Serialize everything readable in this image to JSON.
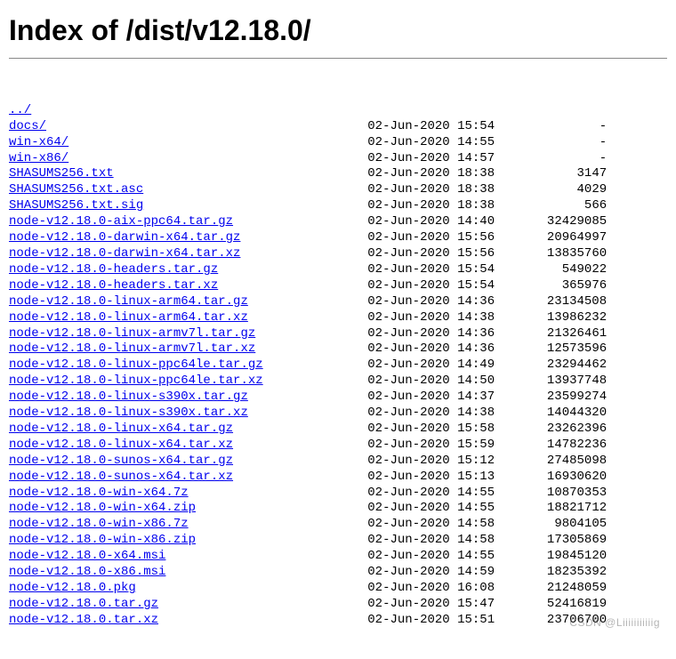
{
  "title": "Index of /dist/v12.18.0/",
  "parent_label": "../",
  "watermark": "CSDN @Liiiiiiiiiiig",
  "columns": {
    "name_width": 48,
    "date_width": 20,
    "size_width": 12
  },
  "entries": [
    {
      "name": "docs/",
      "date": "02-Jun-2020 15:54",
      "size": "-"
    },
    {
      "name": "win-x64/",
      "date": "02-Jun-2020 14:55",
      "size": "-"
    },
    {
      "name": "win-x86/",
      "date": "02-Jun-2020 14:57",
      "size": "-"
    },
    {
      "name": "SHASUMS256.txt",
      "date": "02-Jun-2020 18:38",
      "size": "3147"
    },
    {
      "name": "SHASUMS256.txt.asc",
      "date": "02-Jun-2020 18:38",
      "size": "4029"
    },
    {
      "name": "SHASUMS256.txt.sig",
      "date": "02-Jun-2020 18:38",
      "size": "566"
    },
    {
      "name": "node-v12.18.0-aix-ppc64.tar.gz",
      "date": "02-Jun-2020 14:40",
      "size": "32429085"
    },
    {
      "name": "node-v12.18.0-darwin-x64.tar.gz",
      "date": "02-Jun-2020 15:56",
      "size": "20964997"
    },
    {
      "name": "node-v12.18.0-darwin-x64.tar.xz",
      "date": "02-Jun-2020 15:56",
      "size": "13835760"
    },
    {
      "name": "node-v12.18.0-headers.tar.gz",
      "date": "02-Jun-2020 15:54",
      "size": "549022"
    },
    {
      "name": "node-v12.18.0-headers.tar.xz",
      "date": "02-Jun-2020 15:54",
      "size": "365976"
    },
    {
      "name": "node-v12.18.0-linux-arm64.tar.gz",
      "date": "02-Jun-2020 14:36",
      "size": "23134508"
    },
    {
      "name": "node-v12.18.0-linux-arm64.tar.xz",
      "date": "02-Jun-2020 14:38",
      "size": "13986232"
    },
    {
      "name": "node-v12.18.0-linux-armv7l.tar.gz",
      "date": "02-Jun-2020 14:36",
      "size": "21326461"
    },
    {
      "name": "node-v12.18.0-linux-armv7l.tar.xz",
      "date": "02-Jun-2020 14:36",
      "size": "12573596"
    },
    {
      "name": "node-v12.18.0-linux-ppc64le.tar.gz",
      "date": "02-Jun-2020 14:49",
      "size": "23294462"
    },
    {
      "name": "node-v12.18.0-linux-ppc64le.tar.xz",
      "date": "02-Jun-2020 14:50",
      "size": "13937748"
    },
    {
      "name": "node-v12.18.0-linux-s390x.tar.gz",
      "date": "02-Jun-2020 14:37",
      "size": "23599274"
    },
    {
      "name": "node-v12.18.0-linux-s390x.tar.xz",
      "date": "02-Jun-2020 14:38",
      "size": "14044320"
    },
    {
      "name": "node-v12.18.0-linux-x64.tar.gz",
      "date": "02-Jun-2020 15:58",
      "size": "23262396"
    },
    {
      "name": "node-v12.18.0-linux-x64.tar.xz",
      "date": "02-Jun-2020 15:59",
      "size": "14782236"
    },
    {
      "name": "node-v12.18.0-sunos-x64.tar.gz",
      "date": "02-Jun-2020 15:12",
      "size": "27485098"
    },
    {
      "name": "node-v12.18.0-sunos-x64.tar.xz",
      "date": "02-Jun-2020 15:13",
      "size": "16930620"
    },
    {
      "name": "node-v12.18.0-win-x64.7z",
      "date": "02-Jun-2020 14:55",
      "size": "10870353"
    },
    {
      "name": "node-v12.18.0-win-x64.zip",
      "date": "02-Jun-2020 14:55",
      "size": "18821712"
    },
    {
      "name": "node-v12.18.0-win-x86.7z",
      "date": "02-Jun-2020 14:58",
      "size": "9804105"
    },
    {
      "name": "node-v12.18.0-win-x86.zip",
      "date": "02-Jun-2020 14:58",
      "size": "17305869"
    },
    {
      "name": "node-v12.18.0-x64.msi",
      "date": "02-Jun-2020 14:55",
      "size": "19845120"
    },
    {
      "name": "node-v12.18.0-x86.msi",
      "date": "02-Jun-2020 14:59",
      "size": "18235392"
    },
    {
      "name": "node-v12.18.0.pkg",
      "date": "02-Jun-2020 16:08",
      "size": "21248059"
    },
    {
      "name": "node-v12.18.0.tar.gz",
      "date": "02-Jun-2020 15:47",
      "size": "52416819"
    },
    {
      "name": "node-v12.18.0.tar.xz",
      "date": "02-Jun-2020 15:51",
      "size": "23706700"
    }
  ]
}
